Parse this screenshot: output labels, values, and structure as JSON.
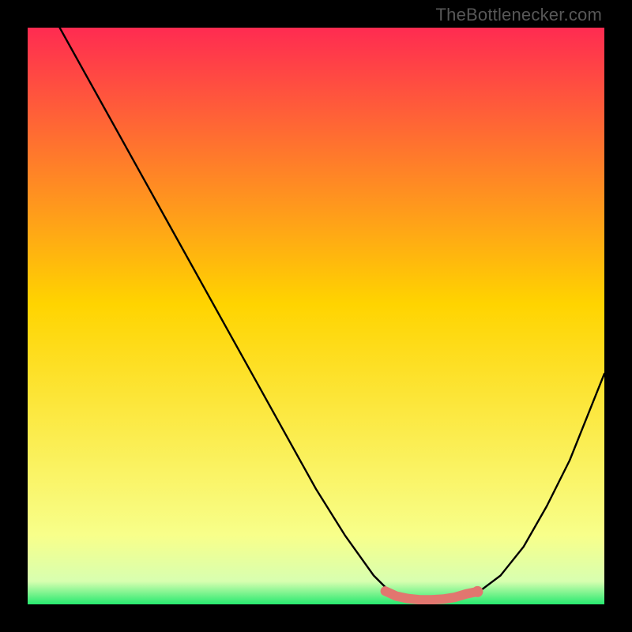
{
  "credit": "TheBottlenecker.com",
  "colors": {
    "top": "#ff2b51",
    "mid": "#ffd400",
    "nearBottom": "#f8ff8a",
    "bottom": "#27e96f",
    "curve": "#000000",
    "marker": "#e2766f"
  },
  "chart_data": {
    "type": "line",
    "title": "",
    "xlabel": "",
    "ylabel": "",
    "xlim": [
      0,
      100
    ],
    "ylim": [
      0,
      100
    ],
    "series": [
      {
        "name": "bottleneck-curve",
        "x": [
          0,
          5,
          10,
          15,
          20,
          25,
          30,
          35,
          40,
          45,
          50,
          55,
          60,
          63,
          66,
          70,
          74,
          78,
          82,
          86,
          90,
          94,
          100
        ],
        "y": [
          110,
          101,
          92,
          83,
          74,
          65,
          56,
          47,
          38,
          29,
          20,
          12,
          5,
          2,
          1,
          1,
          1,
          2,
          5,
          10,
          17,
          25,
          40
        ]
      }
    ],
    "highlight": {
      "name": "optimal-range",
      "x": [
        62,
        64,
        66,
        68,
        70,
        72,
        74,
        76,
        78
      ],
      "y": [
        2.3,
        1.4,
        1.0,
        0.8,
        0.8,
        0.9,
        1.2,
        1.8,
        2.2
      ]
    },
    "highlight_end_marker": {
      "x": 78,
      "y": 2.2
    }
  }
}
